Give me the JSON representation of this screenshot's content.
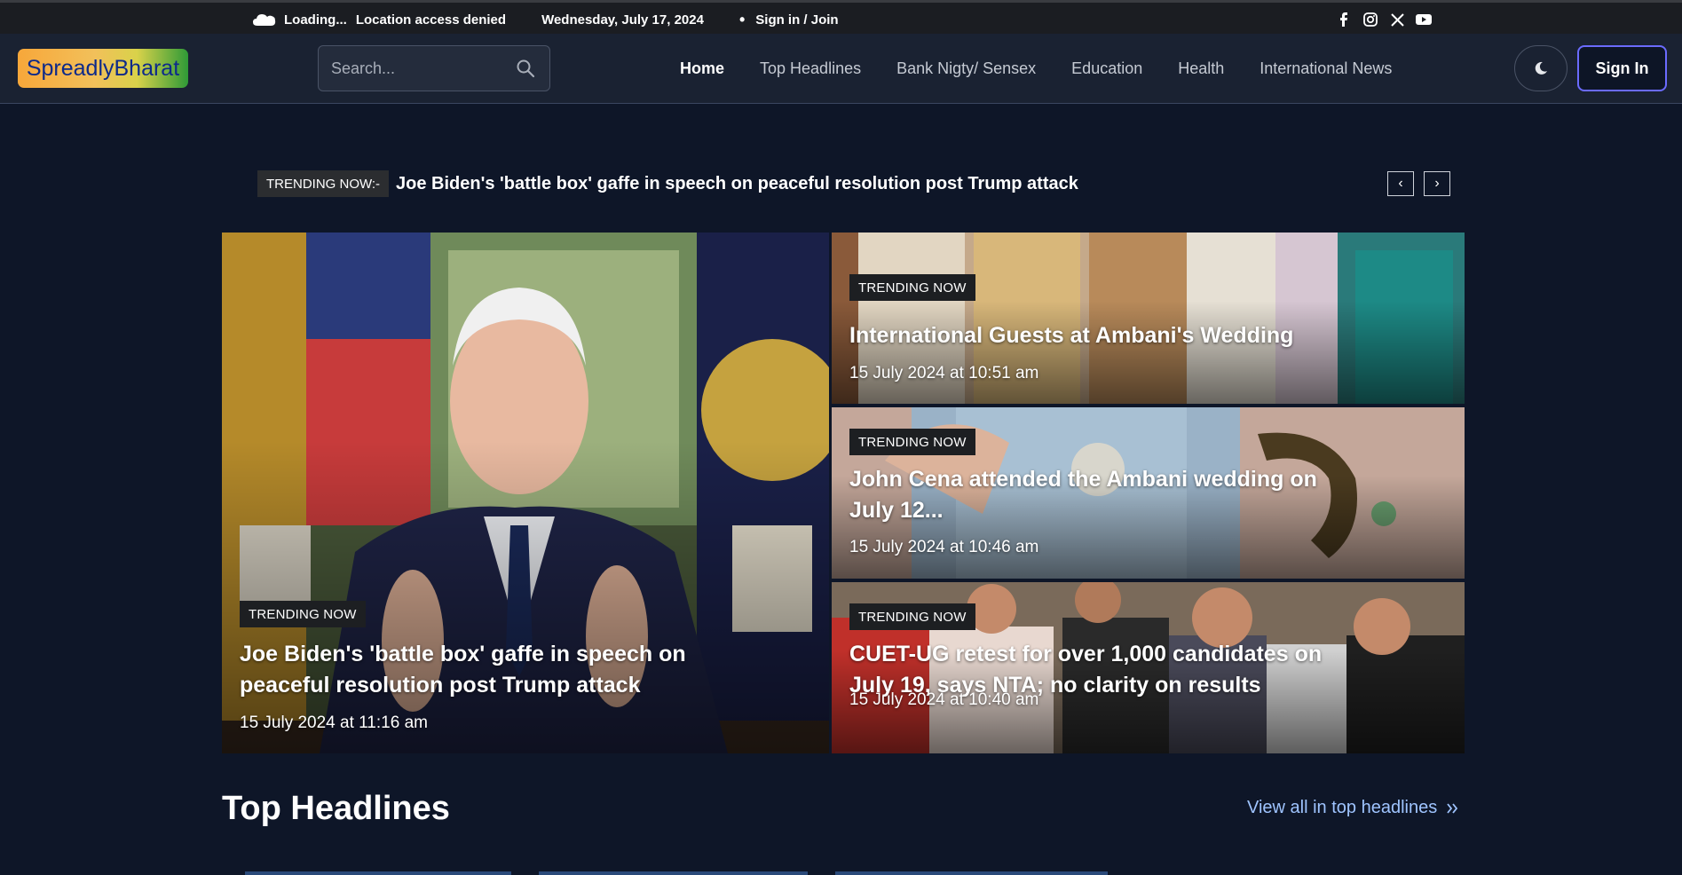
{
  "topbar": {
    "weather_icon": "cloud-icon",
    "loading_text": "Loading...",
    "location_text": "Location access denied",
    "date_text": "Wednesday, July 17, 2024",
    "bullet": "•",
    "signin_text": "Sign in / Join",
    "social_icons": [
      "facebook-icon",
      "instagram-icon",
      "x-icon",
      "youtube-icon"
    ]
  },
  "header": {
    "logo_text": "SpreadlyBharat",
    "search_placeholder": "Search...",
    "nav": [
      {
        "label": "Home",
        "active": true
      },
      {
        "label": "Top Headlines"
      },
      {
        "label": "Bank Nigty/ Sensex"
      },
      {
        "label": "Education"
      },
      {
        "label": "Health"
      },
      {
        "label": "International News"
      }
    ],
    "theme_icon": "moon-icon",
    "signin_button": "Sign In"
  },
  "ticker": {
    "label": "TRENDING NOW:-",
    "headline": "Joe Biden's 'battle box' gaffe in speech on peaceful resolution post Trump attack",
    "prev": "‹",
    "next": "›"
  },
  "hero": {
    "main": {
      "badge": "TRENDING NOW",
      "title": "Joe Biden's 'battle box' gaffe in speech on peaceful resolution post Trump attack",
      "date": "15 July 2024 at 11:16 am"
    },
    "side": [
      {
        "badge": "TRENDING NOW",
        "title": "International Guests at Ambani's Wedding",
        "date": "15 July 2024 at 10:51 am"
      },
      {
        "badge": "TRENDING NOW",
        "title": "John Cena attended the Ambani wedding on July 12...",
        "date": "15 July 2024 at 10:46 am"
      },
      {
        "badge": "TRENDING NOW",
        "title": "CUET-UG retest for over 1,000 candidates on July 19, says NTA; no clarity on results",
        "date": "15 July 2024 at 10:40 am"
      }
    ]
  },
  "section": {
    "title": "Top Headlines",
    "view_all": "View all in top headlines",
    "view_all_icon": "double-chevron-right-icon"
  },
  "colors": {
    "page_bg": "#0e1628",
    "navbar_bg": "#1a2232",
    "topbar_bg": "#1b1d22",
    "link_accent": "#9fc4ff",
    "signin_border": "#6b6bff"
  }
}
